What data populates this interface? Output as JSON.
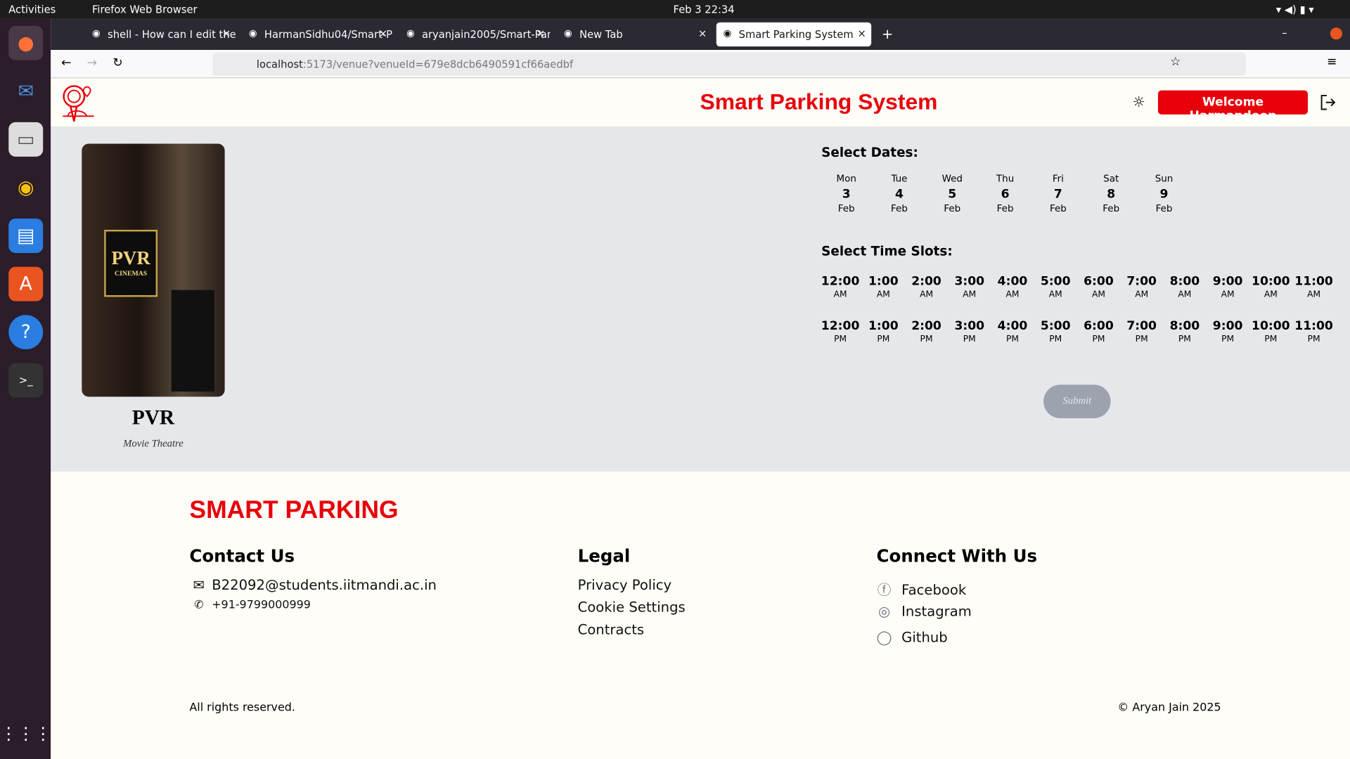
{
  "system": {
    "activities": "Activities",
    "app_menu": "Firefox Web Browser",
    "clock": "Feb 3  22:34"
  },
  "browser": {
    "tabs": [
      {
        "label": "shell - How can I edit the"
      },
      {
        "label": "HarmanSidhu04/Smart-P"
      },
      {
        "label": "aryanjain2005/Smart-Par"
      },
      {
        "label": "New Tab"
      },
      {
        "label": "Smart Parking System",
        "active": true
      }
    ],
    "url_host": "localhost",
    "url_rest": ":5173/venue?venueId=679e8dcb6490591cf66aedbf"
  },
  "header": {
    "title": "Smart Parking System",
    "welcome": "Welcome Harmandeep",
    "accent": "#e8000b"
  },
  "venue": {
    "image_text": "PVR",
    "image_subtext": "CINEMAS",
    "name": "PVR",
    "type": "Movie Theatre"
  },
  "booking": {
    "dates_title": "Select Dates:",
    "dates": [
      {
        "day": "Mon",
        "date": "3",
        "month": "Feb"
      },
      {
        "day": "Tue",
        "date": "4",
        "month": "Feb"
      },
      {
        "day": "Wed",
        "date": "5",
        "month": "Feb"
      },
      {
        "day": "Thu",
        "date": "6",
        "month": "Feb"
      },
      {
        "day": "Fri",
        "date": "7",
        "month": "Feb"
      },
      {
        "day": "Sat",
        "date": "8",
        "month": "Feb"
      },
      {
        "day": "Sun",
        "date": "9",
        "month": "Feb"
      }
    ],
    "slots_title": "Select Time Slots:",
    "slots_am": [
      "12:00",
      "1:00",
      "2:00",
      "3:00",
      "4:00",
      "5:00",
      "6:00",
      "7:00",
      "8:00",
      "9:00",
      "10:00",
      "11:00"
    ],
    "slots_pm": [
      "12:00",
      "1:00",
      "2:00",
      "3:00",
      "4:00",
      "5:00",
      "6:00",
      "7:00",
      "8:00",
      "9:00",
      "10:00",
      "11:00"
    ],
    "am": "AM",
    "pm": "PM",
    "submit": "Submit"
  },
  "footer": {
    "brand": "SMART PARKING",
    "contact_title": "Contact Us",
    "email": "B22092@students.iitmandi.ac.in",
    "phone": "+91-9799000999",
    "legal_title": "Legal",
    "legal": [
      "Privacy Policy",
      "Cookie Settings",
      "Contracts"
    ],
    "connect_title": "Connect With Us",
    "social": [
      "Facebook",
      "Instagram",
      "Github"
    ],
    "rights": "All rights reserved.",
    "copyright": "© Aryan Jain 2025"
  }
}
